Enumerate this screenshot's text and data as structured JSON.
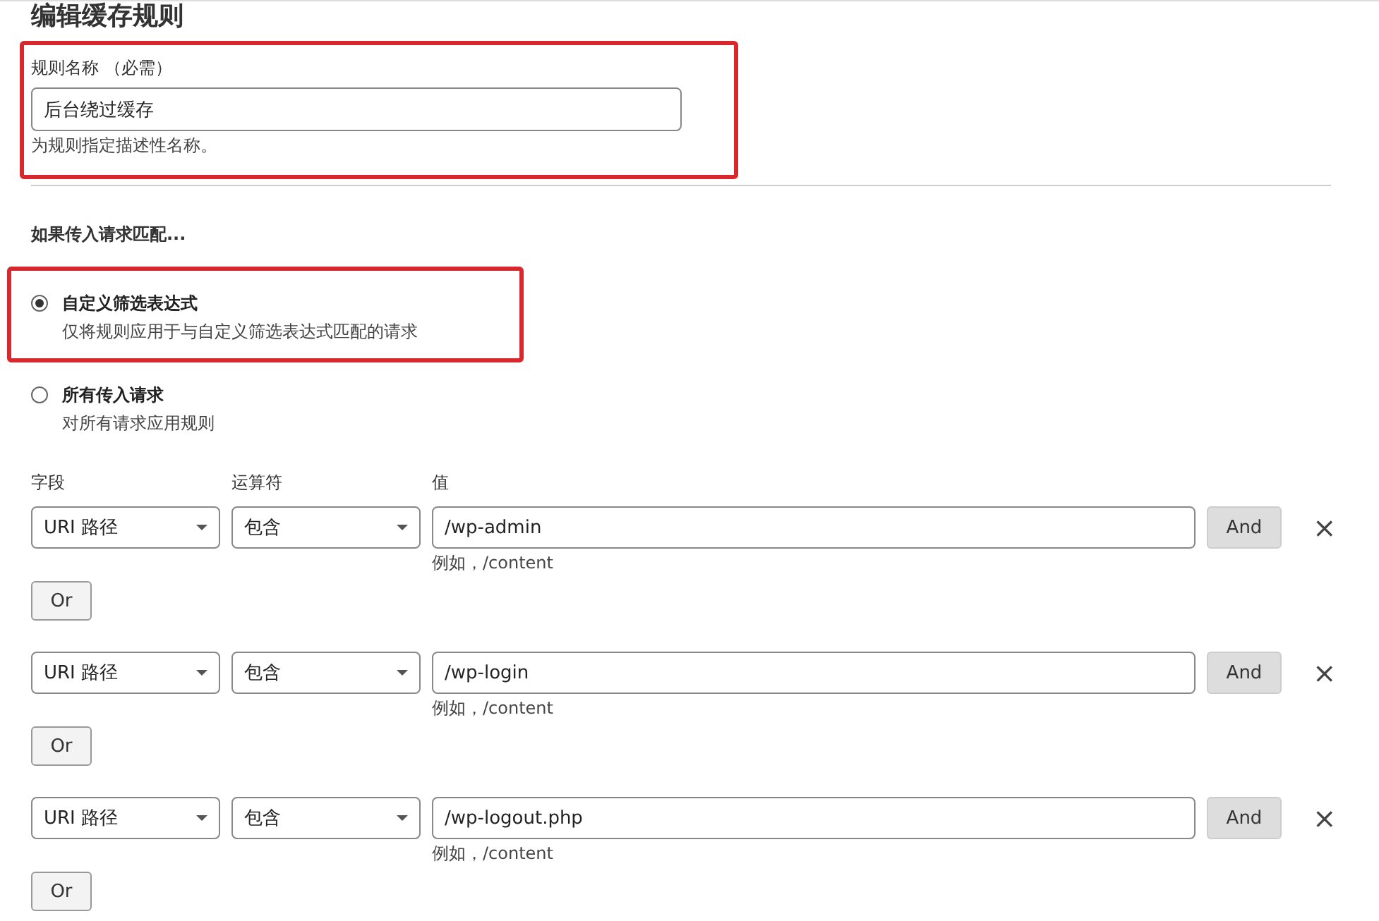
{
  "title": "编辑缓存规则",
  "rule_name": {
    "label": "规则名称 （必需）",
    "value": "后台绕过缓存",
    "hint": "为规则指定描述性名称。",
    "highlighted": true
  },
  "match": {
    "heading": "如果传入请求匹配...",
    "options": [
      {
        "title": "自定义筛选表达式",
        "description": "仅将规则应用于与自定义筛选表达式匹配的请求",
        "selected": true,
        "highlighted": true
      },
      {
        "title": "所有传入请求",
        "description": "对所有请求应用规则",
        "selected": false,
        "highlighted": false
      }
    ]
  },
  "filters": {
    "columns": [
      "字段",
      "运算符",
      "值"
    ],
    "rows": [
      {
        "field": "URI 路径",
        "operator": "包含",
        "value": "/wp-admin",
        "hint": "例如，/content",
        "and_button": "And",
        "remove": "×",
        "or_button": "Or"
      },
      {
        "field": "URI 路径",
        "operator": "包含",
        "value": "/wp-login",
        "hint": "例如，/content",
        "and_button": "And",
        "remove": "×",
        "or_button": "Or"
      },
      {
        "field": "URI 路径",
        "operator": "包含",
        "value": "/wp-logout.php",
        "hint": "例如，/content",
        "and_button": "And",
        "remove": "×",
        "or_button": "Or"
      }
    ]
  }
}
